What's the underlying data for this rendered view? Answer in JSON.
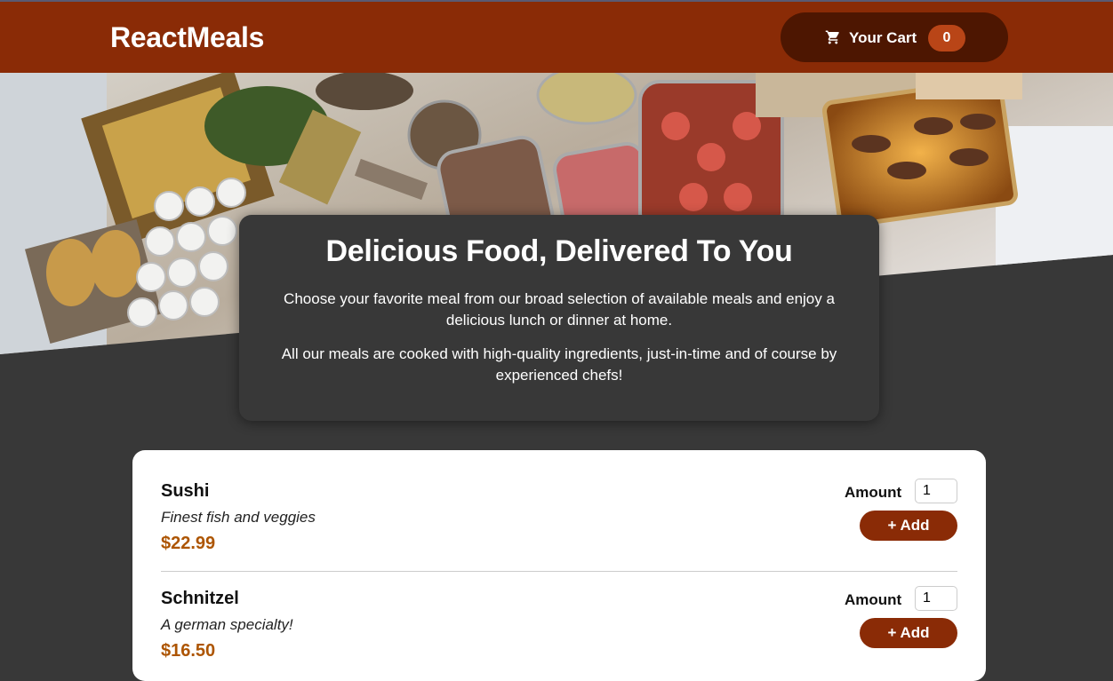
{
  "header": {
    "logo": "ReactMeals",
    "cart": {
      "label": "Your Cart",
      "count": "0",
      "icon": "cart-icon"
    }
  },
  "summary": {
    "title": "Delicious Food, Delivered To You",
    "paragraph1": "Choose your favorite meal from our broad selection of available meals and enjoy a delicious lunch or dinner at home.",
    "paragraph2": "All our meals are cooked with high-quality ingredients, just-in-time and of course by experienced chefs!"
  },
  "meals": [
    {
      "name": "Sushi",
      "description": "Finest fish and veggies",
      "price": "$22.99",
      "amount_label": "Amount",
      "amount_value": "1",
      "add_label": "+ Add"
    },
    {
      "name": "Schnitzel",
      "description": "A german specialty!",
      "price": "$16.50",
      "amount_label": "Amount",
      "amount_value": "1",
      "add_label": "+ Add"
    }
  ],
  "colors": {
    "header_bg": "#8a2b06",
    "cart_bg": "#4d1601",
    "badge_bg": "#b94517",
    "body_bg": "#383838",
    "price": "#ad5502"
  }
}
